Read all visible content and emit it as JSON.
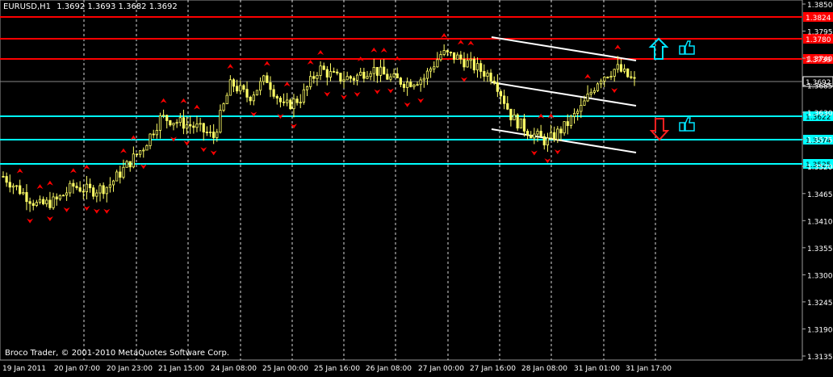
{
  "header": {
    "symbol": "EURUSD,H1",
    "ohlc": "1.3692 1.3693 1.3682 1.3692"
  },
  "footer": {
    "copyright": "Broco Trader, © 2001-2010 MetaQuotes Software Corp."
  },
  "colors": {
    "background": "#000000",
    "candle": "#ffff66",
    "grid": "#ffffff",
    "resistance": "#ff0000",
    "support": "#00ffff",
    "fractal": "#ff0000",
    "channel": "#ffffff",
    "current_price_bg": "#000000"
  },
  "chart_data": {
    "type": "line",
    "title": "EURUSD,H1",
    "y_axis_ticks": [
      "1.3850",
      "1.3795",
      "1.3740",
      "1.3685",
      "1.3630",
      "1.3575",
      "1.3520",
      "1.3465",
      "1.3410",
      "1.3355",
      "1.3300",
      "1.3245",
      "1.3190",
      "1.3135"
    ],
    "x_axis_ticks": [
      "19 Jan 2011",
      "20 Jan 07:00",
      "20 Jan 23:00",
      "21 Jan 15:00",
      "24 Jan 08:00",
      "25 Jan 00:00",
      "25 Jan 16:00",
      "26 Jan 08:00",
      "27 Jan 00:00",
      "27 Jan 16:00",
      "28 Jan 08:00",
      "31 Jan 01:00",
      "31 Jan 17:00"
    ],
    "resistance_levels": [
      {
        "label": "1.3824",
        "value": 1.3824
      },
      {
        "label": "1.3780",
        "value": 1.378
      },
      {
        "label": "1.3739",
        "value": 1.3739
      }
    ],
    "support_levels": [
      {
        "label": "1.3622",
        "value": 1.3622
      },
      {
        "label": "1.3574",
        "value": 1.3574
      },
      {
        "label": "1.3525",
        "value": 1.3525
      }
    ],
    "current_price": {
      "label": "1.3692",
      "value": 1.3692
    },
    "x": [
      0,
      5,
      10,
      15,
      20,
      25,
      30,
      35,
      40,
      45,
      50,
      55,
      60,
      65,
      70,
      75,
      80,
      85,
      90,
      95,
      100,
      105,
      110,
      115,
      120,
      125,
      130,
      135,
      140,
      145,
      150,
      155,
      160,
      165,
      170,
      175,
      180
    ],
    "close": [
      1.35,
      1.347,
      1.344,
      1.345,
      1.348,
      1.347,
      1.348,
      1.352,
      1.356,
      1.362,
      1.361,
      1.36,
      1.358,
      1.369,
      1.366,
      1.37,
      1.364,
      1.366,
      1.372,
      1.37,
      1.37,
      1.372,
      1.37,
      1.369,
      1.37,
      1.375,
      1.374,
      1.372,
      1.37,
      1.362,
      1.359,
      1.357,
      1.36,
      1.364,
      1.37,
      1.372,
      1.3692
    ],
    "ylim": [
      1.3135,
      1.385
    ],
    "grid": true
  }
}
